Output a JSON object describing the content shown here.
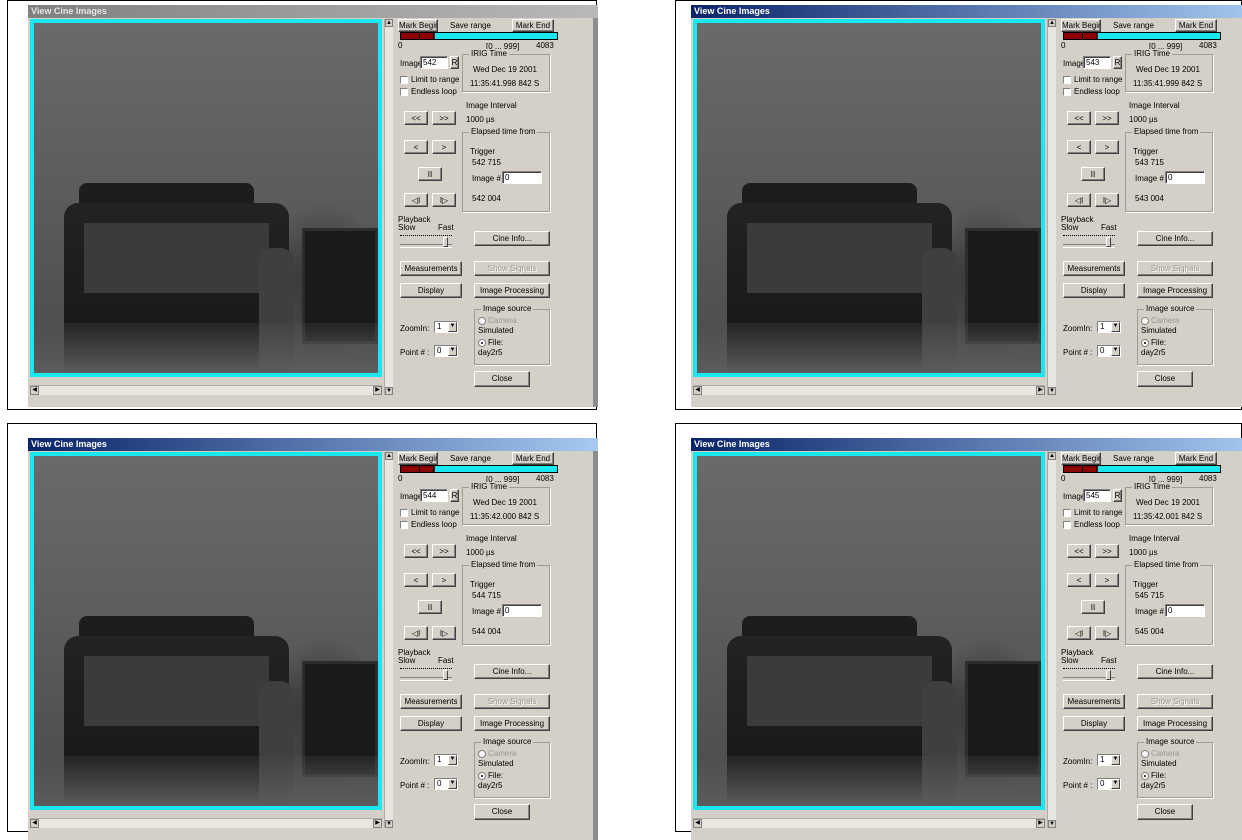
{
  "windows": [
    {
      "title": "View Cine Images",
      "active": false,
      "image_value": "542",
      "irig_date": "Wed Dec 19 2001",
      "irig_time": "11:35:41.998 842 S",
      "trigger_value": "542 715",
      "image_num_value": "0",
      "elapsed_value": "542 004",
      "zoom_value": "1",
      "point_value": "0"
    },
    {
      "title": "View Cine Images",
      "active": true,
      "image_value": "543",
      "irig_date": "Wed Dec 19 2001",
      "irig_time": "11:35:41.999 842 S",
      "trigger_value": "543 715",
      "image_num_value": "0",
      "elapsed_value": "543 004",
      "zoom_value": "1",
      "point_value": "0"
    },
    {
      "title": "View Cine Images",
      "active": true,
      "image_value": "544",
      "irig_date": "Wed Dec 19 2001",
      "irig_time": "11:35:42.000 842 S",
      "trigger_value": "544 715",
      "image_num_value": "0",
      "elapsed_value": "544 004",
      "zoom_value": "1",
      "point_value": "0"
    },
    {
      "title": "View Cine Images",
      "active": true,
      "image_value": "545",
      "irig_date": "Wed Dec 19 2001",
      "irig_time": "11:35:42.001 842 S",
      "trigger_value": "545 715",
      "image_num_value": "0",
      "elapsed_value": "545 004",
      "zoom_value": "1",
      "point_value": "0"
    }
  ],
  "labels": {
    "mark_begin": "Mark Begin",
    "save_range": "Save range",
    "mark_end": "Mark End",
    "range_start": "0",
    "range_mid": "[0 ... 999]",
    "range_end": "4083",
    "image": "Image",
    "r_button": "R",
    "irig_time": "IRIG  Time",
    "limit_to_range": "Limit to range",
    "endless_loop": "Endless loop",
    "image_interval": "Image Interval",
    "interval_value": "1000 µs",
    "rewind": "<<",
    "fast_forward": ">>",
    "step_back": "<",
    "step_forward": ">",
    "pause": "II",
    "play_back": "◁I",
    "play_forward": "I▷",
    "elapsed_time_from": "Elapsed time from",
    "trigger": "Trigger",
    "image_num": "Image #",
    "playback": "Playback",
    "slow": "Slow",
    "fast": "Fast",
    "cine_info": "Cine Info...",
    "measurements": "Measurements",
    "show_signals": "Show Signals",
    "display": "Display",
    "image_processing": "Image Processing",
    "image_source": "Image source",
    "camera": "Camera",
    "simulated": "Simulated",
    "file": "File:",
    "file_name": "day2r5",
    "zoom_in": "ZoomIn:",
    "point_num": "Point # :",
    "close": "Close"
  },
  "playback_speed_fraction": 0.92
}
